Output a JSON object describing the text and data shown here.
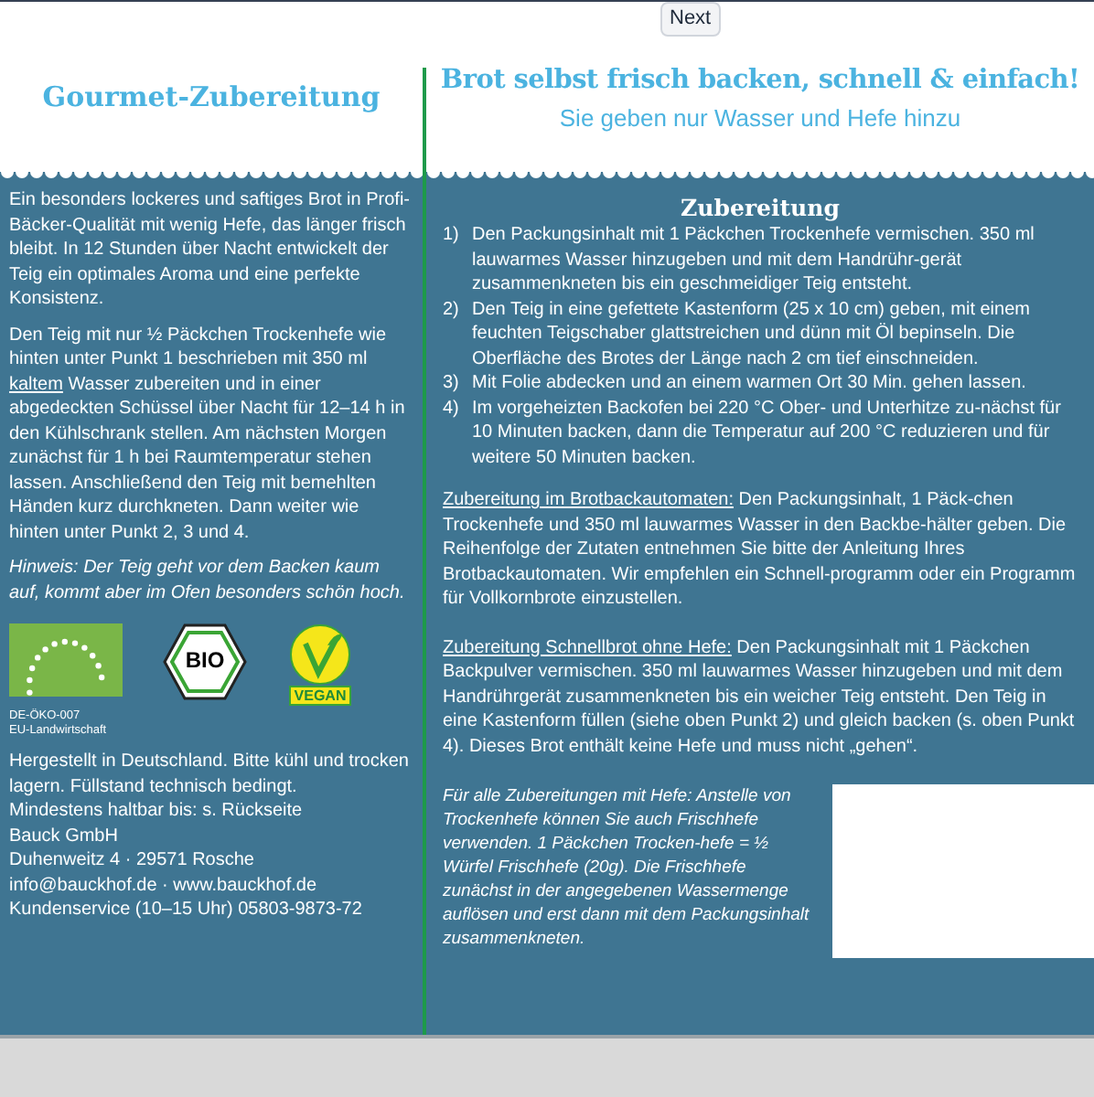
{
  "tooltip": "Next",
  "left": {
    "title": "Gourmet-Zubereitung",
    "paragraphs": [
      [
        {
          "text": "Ein besonders lockeres und saftiges Brot in Profi-Bäcker-Qualität mit wenig Hefe, das länger frisch bleibt. In 12 Stunden über Nacht entwickelt der Teig ein optimales Aroma und eine perfekte Konsistenz.",
          "underlined": false
        }
      ],
      [
        {
          "text": "Den Teig mit nur ½ Päckchen Trockenhefe wie hinten unter Punkt 1 beschrieben mit 350 ml ",
          "underlined": false
        },
        {
          "text": "kaltem",
          "underlined": true
        },
        {
          "text": " Wasser zubereiten und in einer abgedeckten Schüssel über Nacht für 12–14 h in den Kühlschrank stellen. Am nächsten Morgen zunächst für 1 h bei Raumtemperatur stehen lassen. Anschließend den Teig mit bemehlten Händen kurz durchkneten. Dann weiter wie hinten unter Punkt 2, 3 und 4.",
          "underlined": false
        }
      ]
    ],
    "note": "Hinweis: Der Teig geht vor dem Backen kaum auf, kommt aber im Ofen besonders schön hoch.",
    "bio_seal_text": "BIO",
    "vegan_label": "VEGAN",
    "eu_code_lines": [
      "DE-ÖKO-007",
      "EU-Landwirtschaft"
    ],
    "info_lines": [
      "Hergestellt in Deutschland. Bitte kühl und trocken lagern. Füllstand technisch bedingt.",
      "Mindestens haltbar bis: s. Rückseite",
      "Bauck GmbH",
      "Duhenweitz 4 · 29571 Rosche",
      "info@bauckhof.de · www.bauckhof.de",
      "Kundenservice (10–15 Uhr) 05803-9873-72"
    ]
  },
  "right": {
    "headline": "Brot selbst frisch backen, schnell & einfach!",
    "subheadline": "Sie geben nur Wasser und Hefe hinzu",
    "section_title": "Zubereitung",
    "steps": [
      {
        "number": "1)",
        "text": "Den Packungsinhalt mit 1 Päckchen Trockenhefe vermischen. 350 ml lauwarmes Wasser hinzugeben und mit dem Handrühr-gerät zusammenkneten bis ein geschmeidiger Teig entsteht."
      },
      {
        "number": "2)",
        "text": "Den Teig in eine gefettete Kastenform (25 x 10 cm) geben, mit einem feuchten Teigschaber glattstreichen und dünn mit Öl bepinseln. Die Oberfläche des Brotes der Länge nach 2 cm tief einschneiden."
      },
      {
        "number": "3)",
        "text": "Mit Folie abdecken und an einem warmen Ort 30 Min. gehen lassen."
      },
      {
        "number": "4)",
        "text": "Im vorgeheizten Backofen bei 220 °C Ober- und Unterhitze zu-nächst für 10 Minuten backen, dann die Temperatur auf 200 °C reduzieren und für weitere 50 Minuten backen."
      }
    ],
    "sections": [
      {
        "heading": "Zubereitung im Brotbackautomaten:",
        "text": "Den Packungsinhalt, 1 Päck-chen Trockenhefe und 350 ml lauwarmes Wasser in den Backbe-hälter geben. Die Reihenfolge der Zutaten entnehmen Sie bitte der Anleitung Ihres Brotbackautomaten. Wir empfehlen ein Schnell-programm oder ein Programm für Vollkornbrote einzustellen."
      },
      {
        "heading": "Zubereitung Schnellbrot ohne Hefe:",
        "text": "Den Packungsinhalt mit 1 Päckchen Backpulver vermischen. 350 ml lauwarmes Wasser hinzugeben und mit dem Handrührgerät zusammenkneten bis ein weicher Teig entsteht. Den Teig in eine Kastenform füllen (siehe oben Punkt 2) und gleich backen (s. oben Punkt 4). Dieses Brot enthält keine Hefe und muss nicht „gehen“."
      }
    ],
    "yeast_note": "Für alle Zubereitungen mit Hefe: Anstelle von Trockenhefe können Sie auch Frischhefe verwenden. 1 Päckchen Trocken-hefe = ½ Würfel Frischhefe (20g). Die Frischhefe zunächst in der angegebenen Wassermenge auflösen und erst dann mit dem Packungsinhalt zusammenkneten."
  }
}
